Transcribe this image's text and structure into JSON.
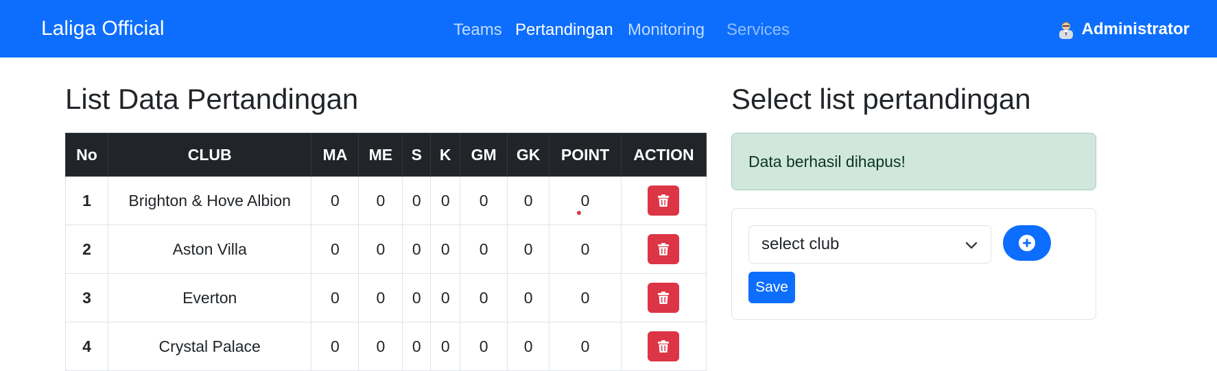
{
  "navbar": {
    "brand": "Laliga Official",
    "links": [
      "Teams",
      "Pertandingan",
      "Monitoring",
      "Services"
    ],
    "active_link": "Pertandingan",
    "user": {
      "name": "Administrator",
      "icon": "user-avatar-icon"
    }
  },
  "left": {
    "title": "List Data Pertandingan",
    "columns": [
      "No",
      "CLUB",
      "MA",
      "ME",
      "S",
      "K",
      "GM",
      "GK",
      "POINT",
      "ACTION"
    ],
    "rows": [
      {
        "no": "1",
        "club": "Brighton & Hove Albion",
        "ma": "0",
        "me": "0",
        "s": "0",
        "k": "0",
        "gm": "0",
        "gk": "0",
        "point": "0"
      },
      {
        "no": "2",
        "club": "Aston Villa",
        "ma": "0",
        "me": "0",
        "s": "0",
        "k": "0",
        "gm": "0",
        "gk": "0",
        "point": "0"
      },
      {
        "no": "3",
        "club": "Everton",
        "ma": "0",
        "me": "0",
        "s": "0",
        "k": "0",
        "gm": "0",
        "gk": "0",
        "point": "0"
      },
      {
        "no": "4",
        "club": "Crystal Palace",
        "ma": "0",
        "me": "0",
        "s": "0",
        "k": "0",
        "gm": "0",
        "gk": "0",
        "point": "0"
      }
    ],
    "action_icon": "trash-icon"
  },
  "right": {
    "title": "Select list pertandingan",
    "alert": "Data berhasil dihapus!",
    "select_value": "select club",
    "add_icon": "plus-circle-icon",
    "save_label": "Save"
  },
  "colors": {
    "primary": "#0d6efd",
    "danger": "#dc3545",
    "dark": "#212529",
    "success_bg": "#d1e7dd"
  }
}
